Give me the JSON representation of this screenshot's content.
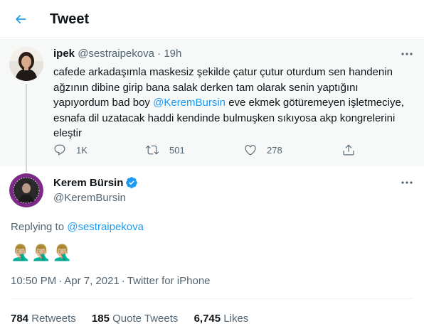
{
  "header": {
    "title": "Tweet",
    "back_icon": "arrow-left-icon",
    "accent_color": "#1d9bf0"
  },
  "parent_tweet": {
    "name": "ipek",
    "handle": "@sestraipekova",
    "separator": "·",
    "time": "19h",
    "text_before": "cafede arkadaşımla maskesiz şekilde çatur çutur oturdum sen handenin ağzının dibine girip bana salak derken tam olarak senin yaptığını yapıyordum bad boy ",
    "mention": "@KeremBursin",
    "text_after": " eve ekmek götüremeyen işletmeciye, esnafa dil uzatacak haddi kendinde bulmuşken sıkıyosa akp kongrelerini eleştir",
    "replies": "1K",
    "retweets": "501",
    "likes": "278",
    "background": "#f7f9f9"
  },
  "main_tweet": {
    "name": "Kerem Bürsin",
    "handle": "@KeremBursin",
    "verified_color": "#1d9bf0",
    "replying_label": "Replying to",
    "replying_to": "@sestraipekova",
    "emojis": "🤦🏼‍♂️🤦🏼‍♂️🤦🏼‍♂️",
    "time": "10:50 PM",
    "separator": "·",
    "date": "Apr 7, 2021",
    "source": "Twitter for iPhone"
  },
  "stats": {
    "retweets_count": "784",
    "retweets_label": "Retweets",
    "quote_count": "185",
    "quote_label": "Quote Tweets",
    "likes_count": "6,745",
    "likes_label": "Likes"
  }
}
